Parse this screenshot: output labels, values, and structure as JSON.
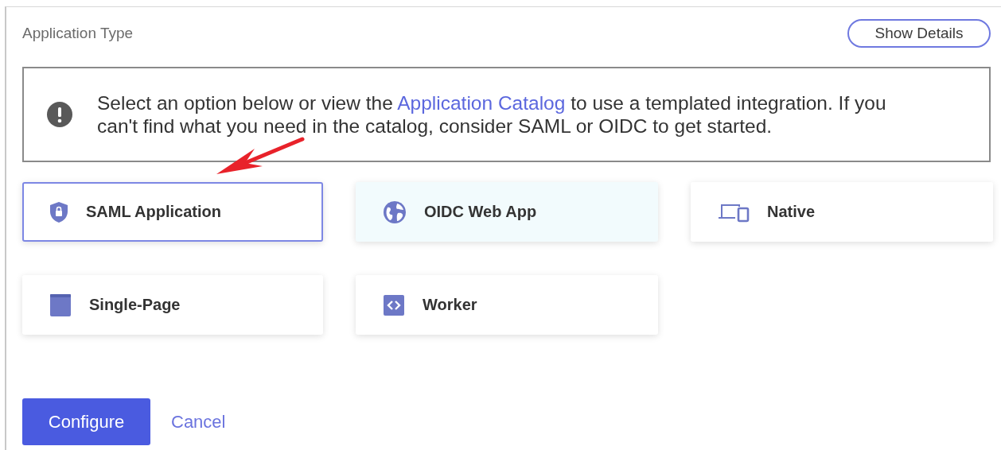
{
  "panel": {
    "title": "Application Type",
    "show_details_button": "Show Details"
  },
  "notice": {
    "text_before": "Select an option below or view the ",
    "link": "Application Catalog",
    "text_after": " to use a templated integration. If you can't find what you need in the catalog, consider SAML or OIDC to get started."
  },
  "options": [
    {
      "label": "SAML Application",
      "kind": "shield",
      "selected": true,
      "hovered": false
    },
    {
      "label": "OIDC Web App",
      "kind": "globe",
      "selected": false,
      "hovered": true
    },
    {
      "label": "Native",
      "kind": "devices",
      "selected": false,
      "hovered": false
    },
    {
      "label": "Single-Page",
      "kind": "window",
      "selected": false,
      "hovered": false
    },
    {
      "label": "Worker",
      "kind": "code",
      "selected": false,
      "hovered": false
    }
  ],
  "actions": {
    "primary": "Configure",
    "secondary": "Cancel"
  }
}
